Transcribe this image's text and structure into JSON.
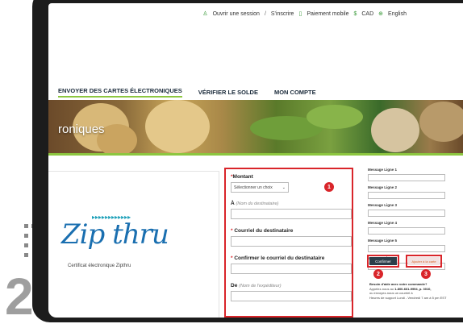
{
  "topbar": {
    "login": "Ouvrir une session",
    "separator": "/",
    "register": "S'inscrire",
    "mobile_payment": "Paiement mobile",
    "currency_symbol": "$",
    "currency": "CAD",
    "language": "English"
  },
  "nav": {
    "items": [
      {
        "label": "ENVOYER DES CARTES ÉLECTRONIQUES"
      },
      {
        "label": "VÉRIFIER LE SOLDE"
      },
      {
        "label": "MON COMPTE"
      }
    ]
  },
  "hero": {
    "title": "roniques"
  },
  "logo": {
    "text": "Zip thru",
    "arrows": "▸▸▸▸▸▸▸▸▸▸▸▸",
    "caption": "Certificat électronique Zipthru"
  },
  "form": {
    "amount_label": "Montant",
    "amount_select": "Sélectionner un choix",
    "to_label": "À",
    "to_hint": "(Nom du destinataire)",
    "email_label": "Courriel du destinataire",
    "confirm_email_label": "Confirmer le courriel du destinataire",
    "from_label": "De",
    "from_hint": "(Nom de l'expéditeur)"
  },
  "message_lines": [
    {
      "label": "Message Ligne 1"
    },
    {
      "label": "Message Ligne 2"
    },
    {
      "label": "Message Ligne 3"
    },
    {
      "label": "Message Ligne 4"
    },
    {
      "label": "Message Ligne 5"
    },
    {
      "label": "Message Ligne 6"
    }
  ],
  "buttons": {
    "confirm": "Confirmer",
    "add_to_cart": "Ajouter à la carte"
  },
  "help": {
    "title": "Besoin d'aide avec votre commande?",
    "line1": "Appelez-nous au",
    "phone": "1-800-661-9994, p. 3010,",
    "line2": "ou envoyez-nous un courriel à",
    "line3": "Heures de support Lundi - Vendredi 7 am à 5 pm EST"
  },
  "badges": [
    "1",
    "2",
    "3"
  ],
  "step_number": "2",
  "colors": {
    "accent_red": "#d9252a",
    "brand_green": "#8cc63f",
    "logo_blue": "#1a6fb0",
    "button_dark": "#2c3e4a"
  }
}
